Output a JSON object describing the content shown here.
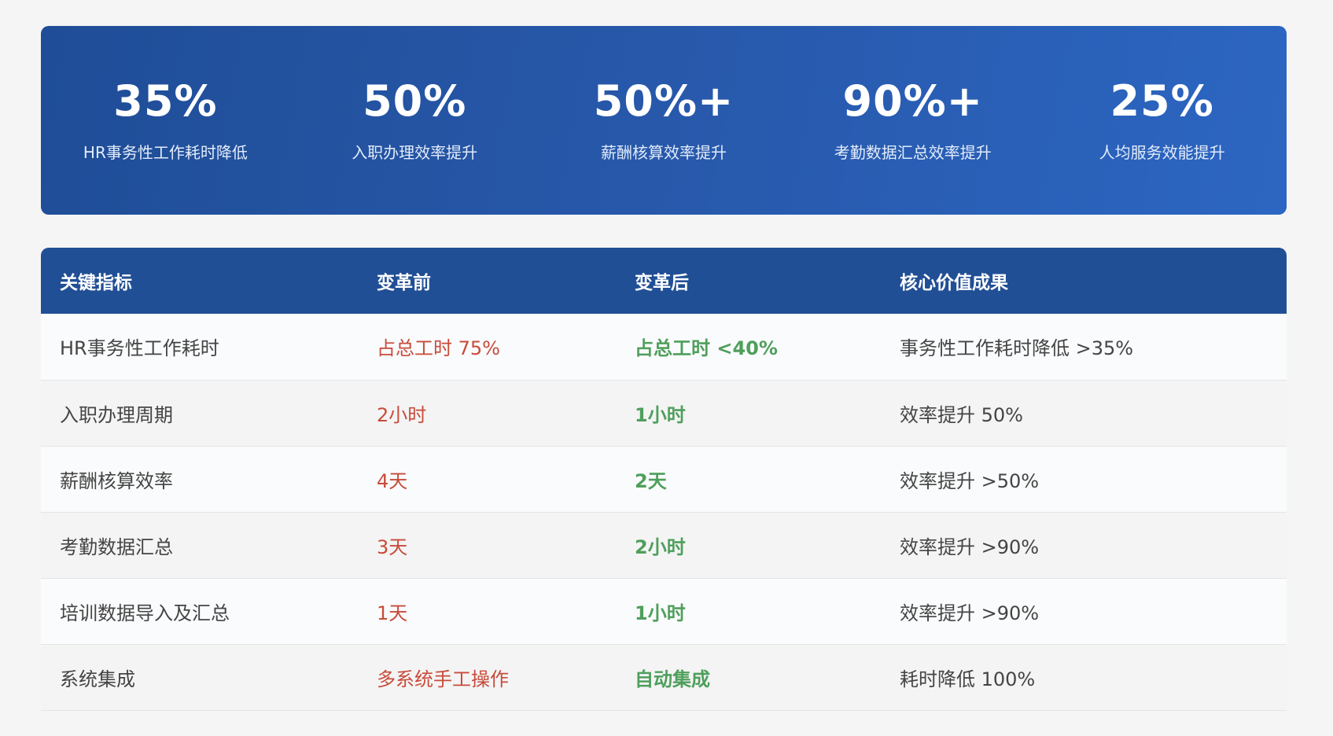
{
  "stats": [
    {
      "value": "35%",
      "label": "HR事务性工作耗时降低"
    },
    {
      "value": "50%",
      "label": "入职办理效率提升"
    },
    {
      "value": "50%+",
      "label": "薪酬核算效率提升"
    },
    {
      "value": "90%+",
      "label": "考勤数据汇总效率提升"
    },
    {
      "value": "25%",
      "label": "人均服务效能提升"
    }
  ],
  "table": {
    "headers": [
      "关键指标",
      "变革前",
      "变革后",
      "核心价值成果"
    ],
    "rows": [
      {
        "metric": "HR事务性工作耗时",
        "before": "占总工时 75%",
        "after": "占总工时 <40%",
        "result": "事务性工作耗时降低 >35%"
      },
      {
        "metric": "入职办理周期",
        "before": "2小时",
        "after": "1小时",
        "result": "效率提升 50%"
      },
      {
        "metric": "薪酬核算效率",
        "before": "4天",
        "after": "2天",
        "result": "效率提升 >50%"
      },
      {
        "metric": "考勤数据汇总",
        "before": "3天",
        "after": "2小时",
        "result": "效率提升 >90%"
      },
      {
        "metric": "培训数据导入及汇总",
        "before": "1天",
        "after": "1小时",
        "result": "效率提升 >90%"
      },
      {
        "metric": "系统集成",
        "before": "多系统手工操作",
        "after": "自动集成",
        "result": "耗时降低 100%"
      }
    ]
  },
  "colors": {
    "banner_start": "#1f4d97",
    "banner_end": "#2c66c2",
    "header_bg": "#214f95",
    "before_text": "#c84b3a",
    "after_text": "#4f9f5c"
  }
}
